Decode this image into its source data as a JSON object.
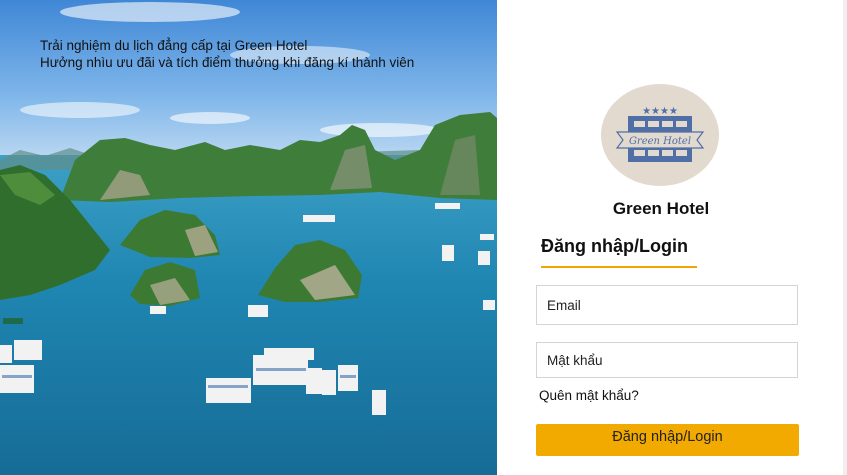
{
  "hero": {
    "line1": "Trải nghiệm du lịch đẳng cấp tại Green Hotel",
    "line2": "Hưởng nhìu ưu đãi và tích điểm thưởng khi đăng kí thành viên"
  },
  "logo": {
    "stars": "★★★★",
    "text": "Green Hotel",
    "bg_color": "#e2d9cf",
    "emblem_color": "#4f6fa6"
  },
  "brand": {
    "name": "Green Hotel"
  },
  "login": {
    "heading": "Đăng nhập/Login",
    "email_placeholder": "Email",
    "password_placeholder": "Mật khẩu",
    "forgot_label": "Quên mật khẩu?",
    "submit_label": "Đăng nhập/Login",
    "accent_color": "#f2aa00"
  }
}
